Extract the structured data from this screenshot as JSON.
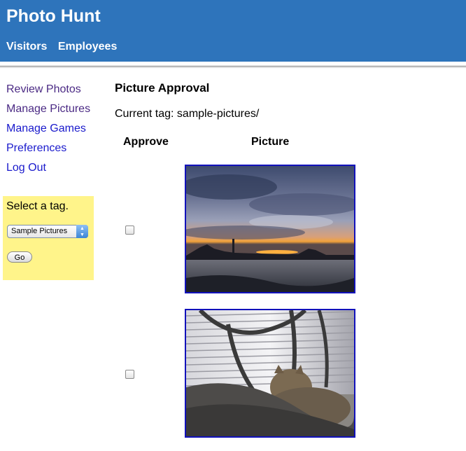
{
  "app": {
    "title": "Photo Hunt"
  },
  "top_nav": [
    {
      "label": "Visitors"
    },
    {
      "label": "Employees"
    }
  ],
  "sidebar": {
    "items": [
      {
        "label": "Review Photos",
        "state": "visited"
      },
      {
        "label": "Manage Pictures",
        "state": "visited"
      },
      {
        "label": "Manage Games",
        "state": "link"
      },
      {
        "label": "Preferences",
        "state": "link"
      },
      {
        "label": "Log Out",
        "state": "link"
      }
    ]
  },
  "tag_box": {
    "title": "Select a tag.",
    "selected": "Sample Pictures",
    "go_label": "Go"
  },
  "main": {
    "title": "Picture Approval",
    "current_tag": "Current tag: sample-pictures/",
    "col_approve": "Approve",
    "col_picture": "Picture"
  },
  "pictures": [
    {
      "subject": "sunset over water",
      "approved": false
    },
    {
      "subject": "cat by window blinds",
      "approved": false
    }
  ],
  "colors": {
    "header_bg": "#2e74bb",
    "tag_box_bg": "#fff48a",
    "visited_link": "#4b2a84",
    "link": "#1a1acc",
    "photo_border": "#1111bb"
  }
}
